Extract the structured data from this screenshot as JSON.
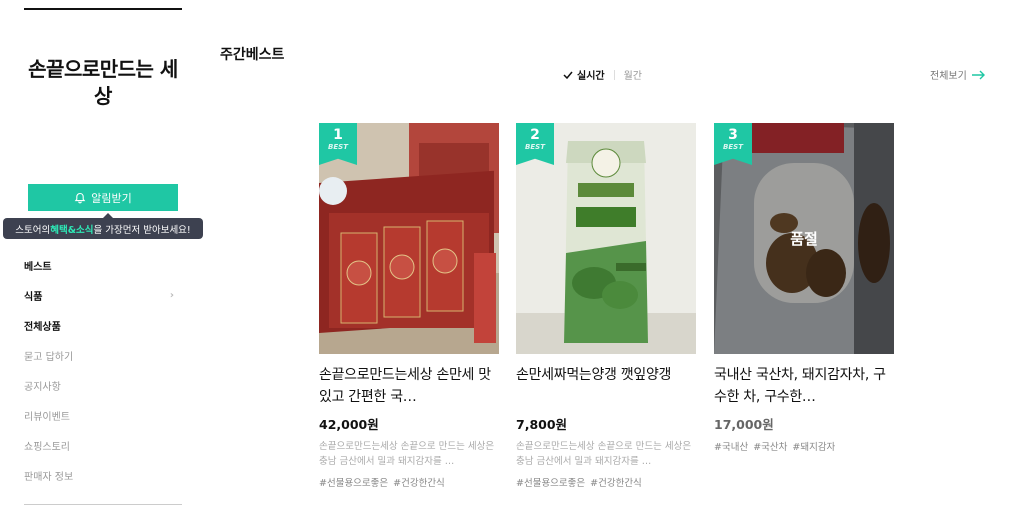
{
  "store": {
    "title": "손끝으로만드는 세상"
  },
  "notify": {
    "label": "알림받기",
    "tooltip_pre": "스토어의 ",
    "tooltip_hl": "혜택&소식",
    "tooltip_post": "을 가장먼저 받아보세요!"
  },
  "menu": [
    {
      "label": "베스트",
      "bold": true
    },
    {
      "label": "식품",
      "bold": true,
      "has_sub": true
    },
    {
      "label": "전체상품",
      "bold": true
    },
    {
      "label": "묻고 답하기",
      "bold": false
    },
    {
      "label": "공지사항",
      "bold": false
    },
    {
      "label": "리뷰이벤트",
      "bold": false
    },
    {
      "label": "쇼핑스토리",
      "bold": false
    },
    {
      "label": "판매자 정보",
      "bold": false
    }
  ],
  "section": {
    "title": "주간베스트",
    "tab_realtime": "실시간",
    "tab_monthly": "월간",
    "view_all": "전체보기"
  },
  "products": [
    {
      "rank": "1",
      "best": "BEST",
      "name": "손끝으로만드는세상 손만세 맛있고 간편한 국…",
      "price": "42,000원",
      "desc": "손끝으로만드는세상 손끝으로 만드는 세상은 충남 금산에서 밀과 돼지감자를 …",
      "tags": [
        "#선물용으로좋은",
        "#건강한간식"
      ],
      "soldout": ""
    },
    {
      "rank": "2",
      "best": "BEST",
      "name": "손만세짜먹는양갱 깻잎양갱",
      "price": "7,800원",
      "desc": "손끝으로만드는세상 손끝으로 만드는 세상은 충남 금산에서 밀과 돼지감자를 …",
      "tags": [
        "#선물용으로좋은",
        "#건강한간식"
      ],
      "soldout": ""
    },
    {
      "rank": "3",
      "best": "BEST",
      "name": "국내산 국산차, 돼지감자차, 구수한 차, 구수한…",
      "price": "17,000원",
      "desc": "",
      "tags": [
        "#국내산",
        "#국산차",
        "#돼지감자"
      ],
      "soldout": "품절"
    }
  ],
  "colors": {
    "accent": "#1fc7a4",
    "tooltip_bg": "#3d4150"
  }
}
